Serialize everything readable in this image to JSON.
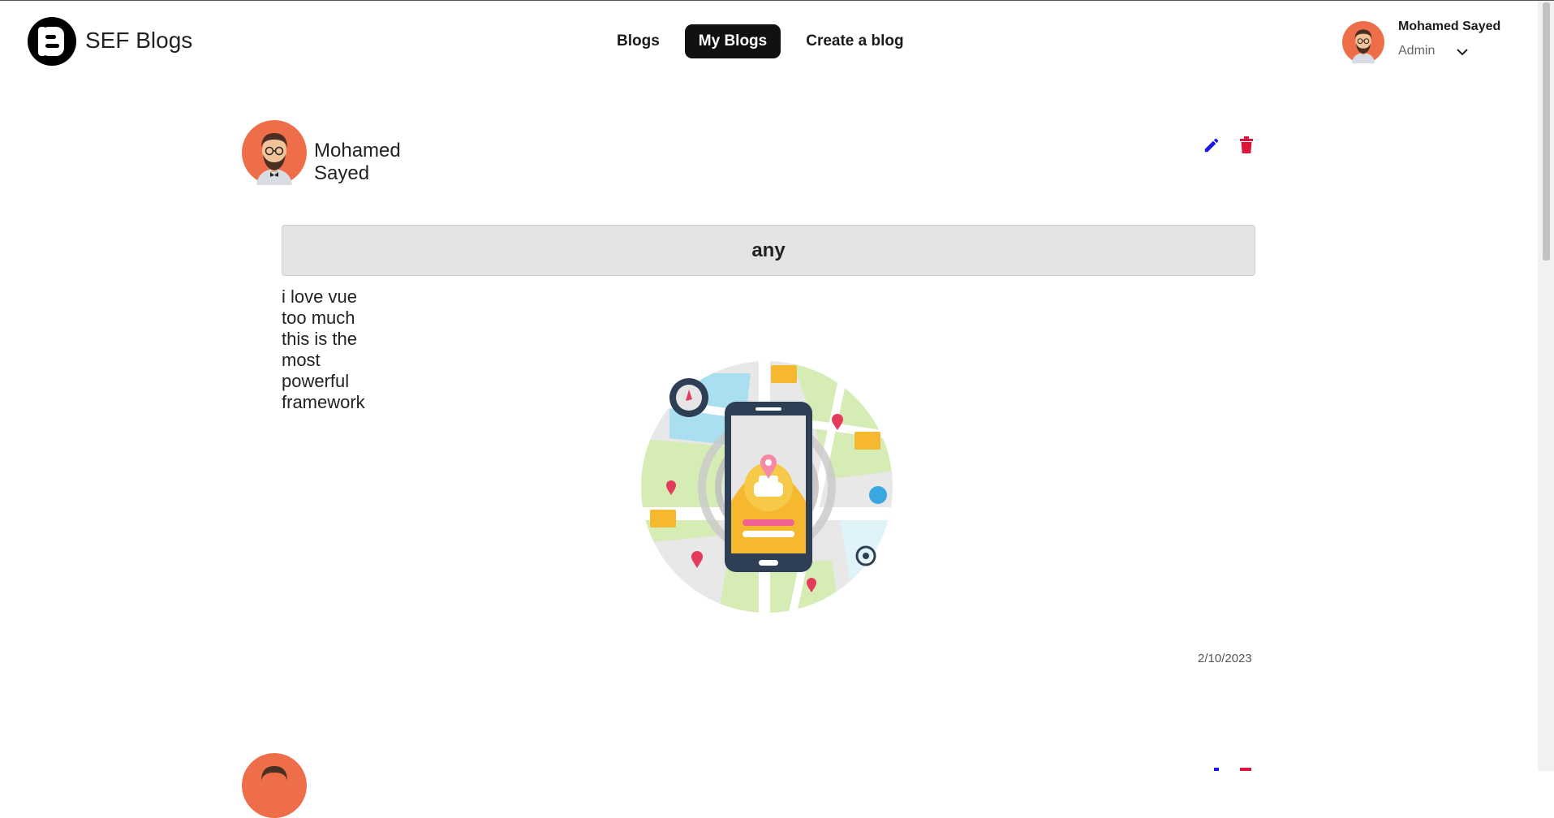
{
  "header": {
    "brand": "SEF Blogs",
    "nav": [
      {
        "label": "Blogs",
        "active": false
      },
      {
        "label": "My Blogs",
        "active": true
      },
      {
        "label": "Create a blog",
        "active": false
      }
    ],
    "user": {
      "name": "Mohamed Sayed",
      "role": "Admin"
    }
  },
  "post": {
    "author": "Mohamed Sayed",
    "title": "any",
    "body": "i love vue too much this is the most powerful framework",
    "date": "2/10/2023"
  },
  "colors": {
    "edit": "#1a1ae6",
    "delete": "#d9163c",
    "active_nav": "#111111",
    "title_bg": "#e3e4e6",
    "avatar_bg": "#ee6e4a"
  }
}
